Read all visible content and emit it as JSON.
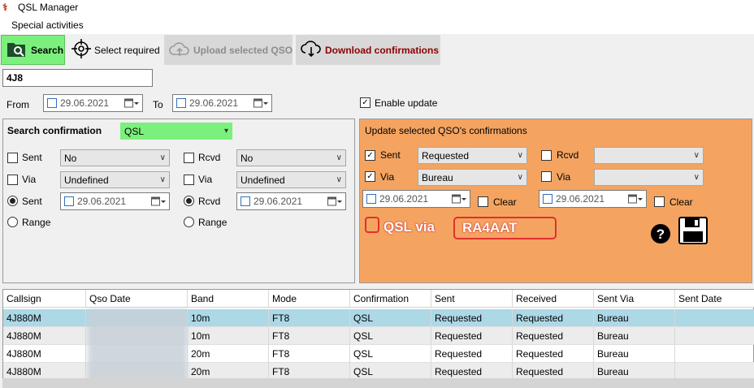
{
  "window": {
    "title": "QSL Manager"
  },
  "menu": {
    "item": "Special activities"
  },
  "toolbar": {
    "search": "Search",
    "select_required": "Select required",
    "upload": "Upload selected QSO",
    "download": "Download confirmations"
  },
  "callsign": {
    "value": "4J8"
  },
  "date_range": {
    "from_label": "From",
    "from_value": "29.06.2021",
    "to_label": "To",
    "to_value": "29.06.2021"
  },
  "enable_update": {
    "label": "Enable update",
    "checked": true
  },
  "search_panel": {
    "title": "Search confirmation",
    "type_value": "QSL",
    "sent_label": "Sent",
    "sent_value": "No",
    "rcvd_label": "Rcvd",
    "rcvd_value": "No",
    "via_label": "Via",
    "via_value": "Undefined",
    "via2_label": "Via",
    "via2_value": "Undefined",
    "radio_sent_label": "Sent",
    "radio_sent_date": "29.06.2021",
    "radio_rcvd_label": "Rcvd",
    "radio_rcvd_date": "29.06.2021",
    "range_label": "Range",
    "range2_label": "Range"
  },
  "update_panel": {
    "title": "Update selected QSO's confirmations",
    "sent_label": "Sent",
    "sent_value": "Requested",
    "rcvd_label": "Rcvd",
    "rcvd_value": "",
    "via_label": "Via",
    "via_value": "Bureau",
    "via2_label": "Via",
    "via2_value": "",
    "date1": "29.06.2021",
    "clear1": "Clear",
    "date2": "29.06.2021",
    "clear2": "Clear",
    "qsl_via_label": "QSL via",
    "qsl_via_value": "RA4AAT"
  },
  "grid": {
    "columns": [
      "Callsign",
      "Qso Date",
      "Band",
      "Mode",
      "Confirmation",
      "Sent",
      "Received",
      "Sent Via",
      "Sent Date"
    ],
    "rows": [
      {
        "callsign": "4J880M",
        "qso_date": "",
        "band": "10m",
        "mode": "FT8",
        "confirmation": "QSL",
        "sent": "Requested",
        "received": "Requested",
        "sent_via": "Bureau",
        "sent_date": ""
      },
      {
        "callsign": "4J880M",
        "qso_date": "",
        "band": "10m",
        "mode": "FT8",
        "confirmation": "QSL",
        "sent": "Requested",
        "received": "Requested",
        "sent_via": "Bureau",
        "sent_date": ""
      },
      {
        "callsign": "4J880M",
        "qso_date": "",
        "band": "20m",
        "mode": "FT8",
        "confirmation": "QSL",
        "sent": "Requested",
        "received": "Requested",
        "sent_via": "Bureau",
        "sent_date": ""
      },
      {
        "callsign": "4J880M",
        "qso_date": "",
        "band": "20m",
        "mode": "FT8",
        "confirmation": "QSL",
        "sent": "Requested",
        "received": "Requested",
        "sent_via": "Bureau",
        "sent_date": ""
      }
    ]
  },
  "colors": {
    "search_button": "#7cf07c",
    "update_panel_bg": "#f4a460",
    "selected_row": "#add8e6",
    "highlight_red": "#e03030"
  },
  "icons": [
    "app-icon",
    "search-folder-icon",
    "crosshair-icon",
    "cloud-upload-icon",
    "cloud-download-icon",
    "calendar-icon",
    "help-icon",
    "save-icon"
  ]
}
